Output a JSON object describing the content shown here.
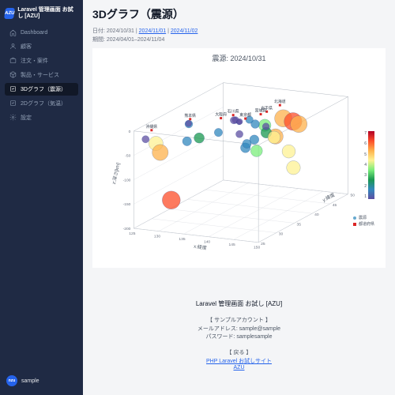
{
  "brand": {
    "logo_text": "AZU",
    "title": "Laravel 管理画面\nお試し [AZU]"
  },
  "sidebar": {
    "items": [
      {
        "label": "Dashboard"
      },
      {
        "label": "顧客"
      },
      {
        "label": "注文・案件"
      },
      {
        "label": "製品・サービス"
      },
      {
        "label": "3Dグラフ（震源）"
      },
      {
        "label": "2Dグラフ（気温）"
      },
      {
        "label": "設定"
      }
    ]
  },
  "user": {
    "avatar_initial": "nzu",
    "name": "sample"
  },
  "page": {
    "title": "3Dグラフ（震源）",
    "date_label": "日付: ",
    "date_links": [
      "2024/10/31",
      "2024/11/01",
      "2024/11/02"
    ],
    "period_label": "期間: ",
    "period_value": "2024/04/01–2024/11/04"
  },
  "legend": {
    "hypo": "震源",
    "pref": "都道府県"
  },
  "colorbar": {
    "ticks": [
      "7",
      "6",
      "5",
      "4",
      "3",
      "2",
      "1"
    ]
  },
  "footer": {
    "title": "Laravel 管理画面 お試し [AZU]",
    "account_head": "【 サンプルアカウント 】",
    "account_mail": "メールアドレス: sample@sample",
    "account_pass": "パスワード: samplesample",
    "back_head": "【 戻る 】",
    "back_links": [
      "PHP Laravel お試しサイト",
      "AZU"
    ]
  },
  "chart_data": {
    "type": "scatter",
    "title": "震源: 2024/10/31",
    "axes": {
      "x": "x:経度",
      "y": "y:緯度",
      "z": "z:深さ[km]"
    },
    "x_range": [
      125,
      150
    ],
    "y_range": [
      25,
      50
    ],
    "z_range": [
      -200,
      0
    ],
    "z_ticks": [
      -200,
      -150,
      -100,
      -50,
      0
    ],
    "y_ticks": [
      25,
      30,
      35,
      40,
      45,
      50
    ],
    "x_ticks": [
      125,
      130,
      135,
      140,
      145,
      150
    ],
    "series": [
      {
        "name": "震源",
        "kind": "bubble",
        "encoding": {
          "size": "magnitude",
          "color": "magnitude"
        },
        "points": [
          {
            "x": 141.2,
            "y": 42.0,
            "z": -60,
            "m": 5.2
          },
          {
            "x": 142.9,
            "y": 41.8,
            "z": -20,
            "m": 6.0
          },
          {
            "x": 140.5,
            "y": 40.0,
            "z": -30,
            "m": 4.0
          },
          {
            "x": 141.5,
            "y": 39.0,
            "z": -40,
            "m": 3.4
          },
          {
            "x": 140.0,
            "y": 38.0,
            "z": -20,
            "m": 2.5
          },
          {
            "x": 139.2,
            "y": 37.5,
            "z": -10,
            "m": 2.1
          },
          {
            "x": 137.0,
            "y": 36.7,
            "z": -10,
            "m": 1.8
          },
          {
            "x": 136.8,
            "y": 36.5,
            "z": -10,
            "m": 2.0
          },
          {
            "x": 135.0,
            "y": 34.7,
            "z": -30,
            "m": 2.4
          },
          {
            "x": 139.7,
            "y": 35.7,
            "z": -60,
            "m": 3.0
          },
          {
            "x": 140.9,
            "y": 36.5,
            "z": -45,
            "m": 2.8
          },
          {
            "x": 130.5,
            "y": 32.7,
            "z": -10,
            "m": 2.2
          },
          {
            "x": 130.3,
            "y": 32.9,
            "z": -10,
            "m": 1.6
          },
          {
            "x": 128.0,
            "y": 27.0,
            "z": -30,
            "m": 4.8
          },
          {
            "x": 128.5,
            "y": 27.5,
            "z": -50,
            "m": 5.5
          },
          {
            "x": 132.0,
            "y": 33.5,
            "z": -40,
            "m": 3.2
          },
          {
            "x": 141.0,
            "y": 37.0,
            "z": -70,
            "m": 3.8
          },
          {
            "x": 143.5,
            "y": 42.5,
            "z": -90,
            "m": 4.4
          },
          {
            "x": 144.0,
            "y": 43.0,
            "z": -30,
            "m": 6.2
          },
          {
            "x": 145.0,
            "y": 43.2,
            "z": -35,
            "m": 5.8
          },
          {
            "x": 137.5,
            "y": 37.0,
            "z": -15,
            "m": 1.2
          },
          {
            "x": 138.2,
            "y": 36.2,
            "z": -10,
            "m": 1.4
          },
          {
            "x": 139.0,
            "y": 35.0,
            "z": -30,
            "m": 2.0
          },
          {
            "x": 140.2,
            "y": 35.4,
            "z": -50,
            "m": 2.6
          },
          {
            "x": 126.5,
            "y": 26.2,
            "z": -20,
            "m": 2.0
          },
          {
            "x": 131.0,
            "y": 31.5,
            "z": -40,
            "m": 2.7
          },
          {
            "x": 142.0,
            "y": 40.5,
            "z": -55,
            "m": 4.1
          },
          {
            "x": 141.8,
            "y": 38.5,
            "z": -25,
            "m": 1.9
          },
          {
            "x": 144.8,
            "y": 42.0,
            "z": -120,
            "m": 4.6
          },
          {
            "x": 130.0,
            "y": 28.5,
            "z": -150,
            "m": 6.3
          }
        ]
      },
      {
        "name": "都道府県",
        "kind": "marker",
        "color": "#dc2626",
        "points": [
          {
            "x": 141.3,
            "y": 43.1,
            "label": "北海道"
          },
          {
            "x": 141.1,
            "y": 39.7,
            "label": "岩手県"
          },
          {
            "x": 140.9,
            "y": 38.3,
            "label": "宮城県"
          },
          {
            "x": 136.6,
            "y": 36.6,
            "label": "石川県"
          },
          {
            "x": 139.7,
            "y": 35.7,
            "label": "東京都"
          },
          {
            "x": 135.5,
            "y": 34.7,
            "label": "大阪府"
          },
          {
            "x": 130.7,
            "y": 32.8,
            "label": "熊本県"
          },
          {
            "x": 127.7,
            "y": 26.2,
            "label": "沖縄県"
          }
        ]
      }
    ]
  }
}
